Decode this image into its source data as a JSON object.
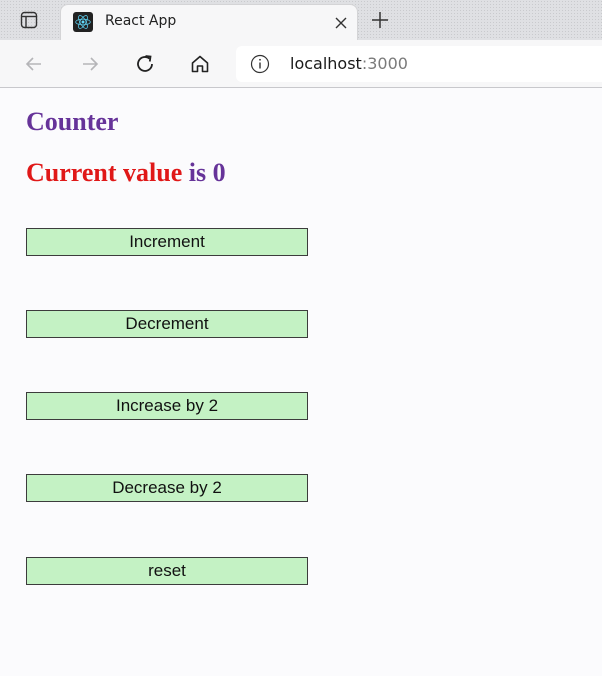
{
  "browser": {
    "tab": {
      "title": "React App"
    },
    "address_bar": {
      "host": "localhost",
      "port": ":3000"
    },
    "icons": {
      "tab_actions": "tab-actions-icon",
      "favicon": "react-logo-icon",
      "close": "close-icon",
      "new_tab": "plus-icon",
      "back": "back-arrow-icon",
      "forward": "forward-arrow-icon",
      "refresh": "refresh-icon",
      "home": "home-icon",
      "site_info": "info-icon"
    }
  },
  "page": {
    "title": "Counter",
    "value_label": "Current value",
    "value_is": "is",
    "value": "0",
    "buttons": {
      "increment": "Increment",
      "decrement": "Decrement",
      "increase_by_2": "Increase by 2",
      "decrease_by_2": "Decrease by 2",
      "reset": "reset"
    }
  },
  "colors": {
    "title": "#663399",
    "value_label": "#e01818",
    "button_bg": "#c4f2c4"
  }
}
